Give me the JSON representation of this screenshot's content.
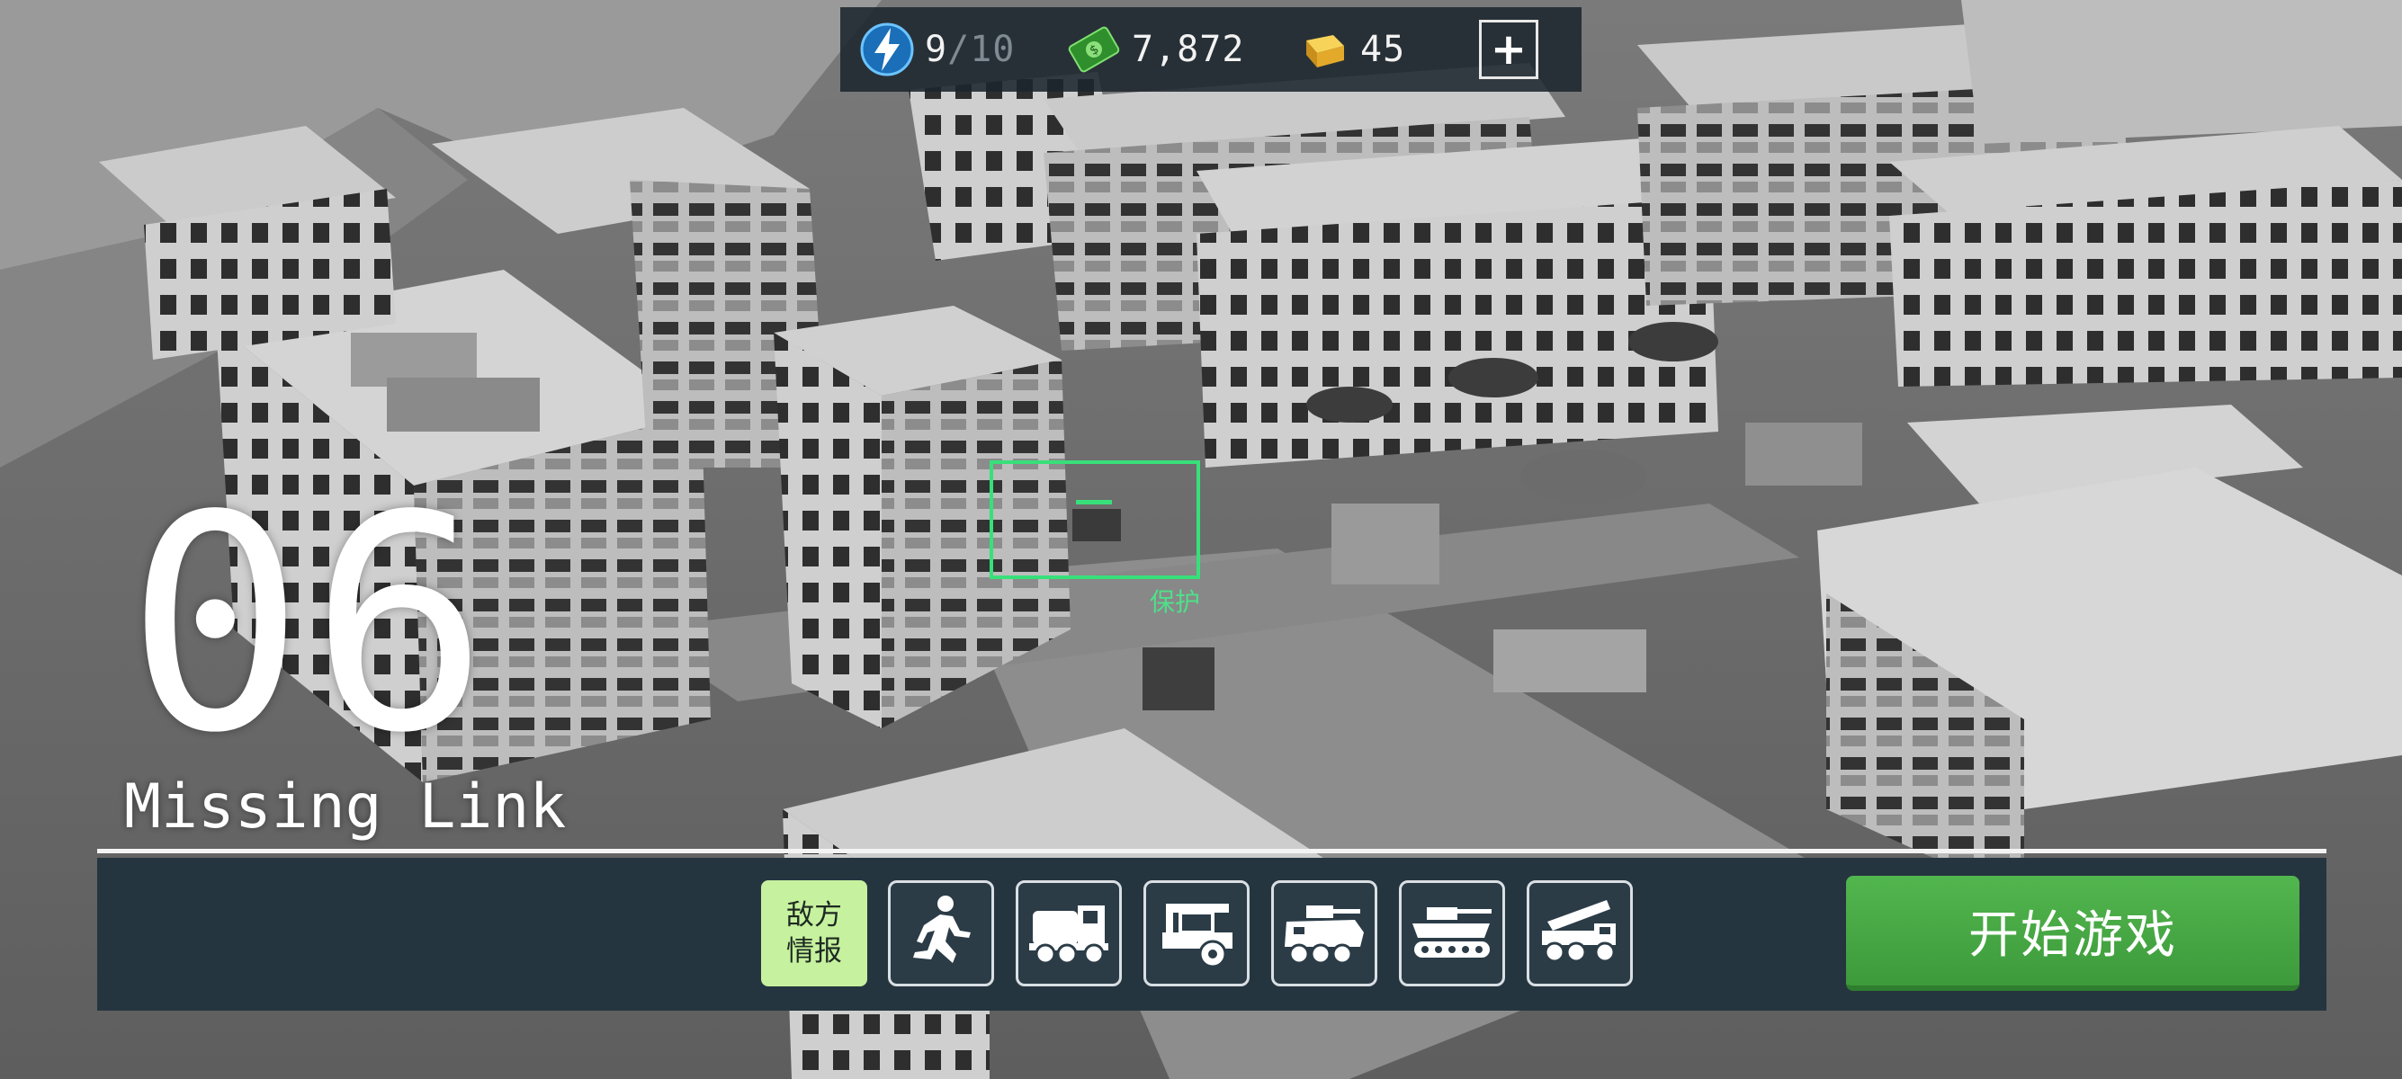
{
  "resources": {
    "energy": {
      "current": "9",
      "separator": "/",
      "max": "10",
      "icon": "lightning-icon",
      "color": "#3aa3e8"
    },
    "cash": {
      "value": "7,872",
      "icon": "cash-icon",
      "color": "#4fc24a"
    },
    "gold": {
      "value": "45",
      "icon": "gold-bar-icon",
      "color": "#e8b62a"
    },
    "add_button": "+"
  },
  "level": {
    "number": "06",
    "name": "Missing Link"
  },
  "objective": {
    "label": "保护",
    "color": "#38e07a"
  },
  "bottom_panel": {
    "intel_button": "敌方\n情报",
    "units": [
      {
        "name": "infantry",
        "icon": "running-soldier-icon"
      },
      {
        "name": "supply-truck",
        "icon": "truck-icon"
      },
      {
        "name": "armored-car",
        "icon": "armored-car-icon"
      },
      {
        "name": "apc",
        "icon": "apc-icon"
      },
      {
        "name": "tank",
        "icon": "tank-icon"
      },
      {
        "name": "missile-launcher",
        "icon": "missile-launcher-icon"
      }
    ],
    "start_button": "开始游戏"
  }
}
